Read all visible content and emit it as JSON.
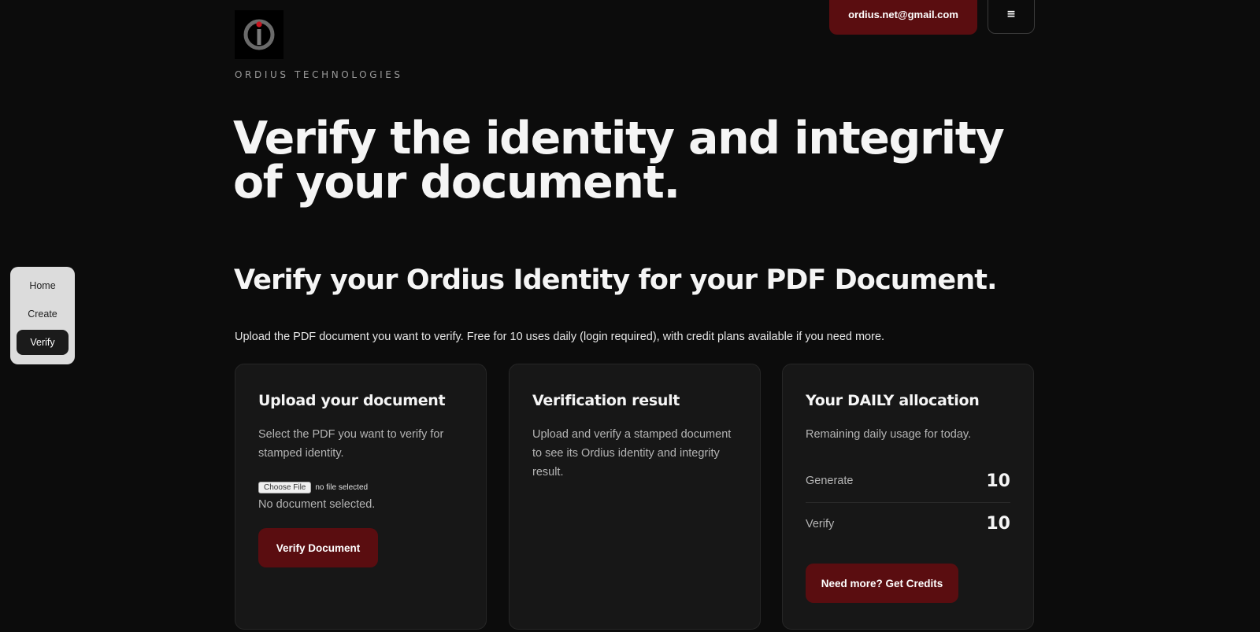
{
  "header": {
    "brand": "ORDIUS TECHNOLOGIES",
    "email": "ordius.net@gmail.com",
    "menu_icon": "≡"
  },
  "hero": {
    "title": "Verify the identity and integrity of your document."
  },
  "section": {
    "title": "Verify your Ordius Identity for your PDF Document.",
    "intro": "Upload the PDF document you want to verify. Free for 10 uses daily (login required), with credit plans available if you need more."
  },
  "side_nav": {
    "items": [
      {
        "label": "Home"
      },
      {
        "label": "Create"
      },
      {
        "label": "Verify"
      }
    ]
  },
  "upload_card": {
    "title": "Upload your document",
    "description": "Select the PDF you want to verify for stamped identity.",
    "choose_file_label": "Choose File",
    "file_status": "no file selected",
    "no_document": "No document selected.",
    "verify_button": "Verify Document"
  },
  "result_card": {
    "title": "Verification result",
    "description": "Upload and verify a stamped document to see its Ordius identity and integrity result."
  },
  "allocation_card": {
    "title": "Your DAILY allocation",
    "description": "Remaining daily usage for today.",
    "rows": [
      {
        "label": "Generate",
        "value": "10"
      },
      {
        "label": "Verify",
        "value": "10"
      }
    ],
    "credits_button": "Need more? Get Credits"
  },
  "colors": {
    "accent": "#5a0d10",
    "background": "#0c0c0c",
    "card": "#171717"
  }
}
